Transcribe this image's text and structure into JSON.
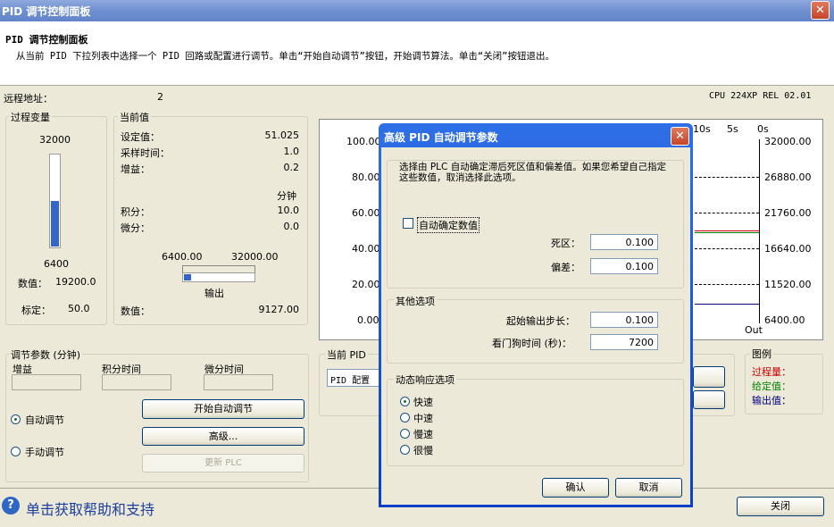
{
  "window": {
    "title": "PID 调节控制面板",
    "close_glyph": "✕"
  },
  "header": {
    "title": "PID 调节控制面板",
    "description": "从当前 PID 下拉列表中选择一个 PID 回路或配置进行调节。单击“开始自动调节”按钮，开始调节算法。单击“关闭”按钮退出。"
  },
  "remote": {
    "label": "远程地址：",
    "value": "2",
    "cpu": "CPU 224XP REL 02.01"
  },
  "process_var": {
    "legend": "过程变量",
    "top": "32000",
    "bottom": "6400",
    "value_label": "数值：",
    "value": "19200.0",
    "calib_label": "标定：",
    "calib": "50.0",
    "fill_fraction": 0.5
  },
  "current": {
    "legend": "当前值",
    "rows": [
      {
        "label": "设定值：",
        "value": "51.025"
      },
      {
        "label": "采样时间：",
        "value": "1.0"
      },
      {
        "label": "增益：",
        "value": "0.2"
      }
    ],
    "unit": "分钟",
    "rows2": [
      {
        "label": "积分：",
        "value": "10.0"
      },
      {
        "label": "微分：",
        "value": "0.0"
      }
    ],
    "out_min": "6400.00",
    "out_max": "32000.00",
    "output_label": "输出",
    "value_label": "数值：",
    "value": "9127.00",
    "out_fraction": 0.1
  },
  "chart": {
    "left_ticks": [
      "100.00",
      "80.00",
      "60.00",
      "40.00",
      "20.00",
      "0.00"
    ],
    "right_ticks": [
      "32000.00",
      "26880.00",
      "21760.00",
      "16640.00",
      "11520.00",
      "6400.00"
    ],
    "time_ticks": [
      "10s",
      "5s",
      "0s"
    ],
    "out_label": "Out"
  },
  "tuning": {
    "legend": "调节参数 (分钟)",
    "gain_label": "增益",
    "integral_label": "积分时间",
    "derivative_label": "微分时间",
    "auto_label": "自动调节",
    "manual_label": "手动调节",
    "start_button": "开始自动调节",
    "advanced_button": "高级...",
    "update_button": "更新 PLC"
  },
  "current_pid": {
    "legend": "当前 PID",
    "select_value": "PID 配置"
  },
  "legend_box": {
    "title": "图例",
    "pv": "过程量：",
    "sp": "给定值：",
    "out": "输出值：",
    "pv_color": "#cc0000",
    "sp_color": "#008000",
    "out_color": "#000080"
  },
  "help": {
    "text": "单击获取帮助和支持",
    "icon": "?"
  },
  "close_button": "关闭",
  "dialog": {
    "title": "高级 PID 自动调节参数",
    "desc": "选择由 PLC 自动确定滞后死区值和偏差值。如果您希望自己指定这些数值，取消选择此选项。",
    "auto_check": "自动确定数值",
    "deadband_label": "死区：",
    "deadband": "0.100",
    "deviation_label": "偏差：",
    "deviation": "0.100",
    "other_legend": "其他选项",
    "step_label": "起始输出步长：",
    "step": "0.100",
    "watchdog_label": "看门狗时间 (秒)：",
    "watchdog": "7200",
    "dyn_legend": "动态响应选项",
    "options": [
      "快速",
      "中速",
      "慢速",
      "很慢"
    ],
    "ok": "确认",
    "cancel": "取消"
  }
}
